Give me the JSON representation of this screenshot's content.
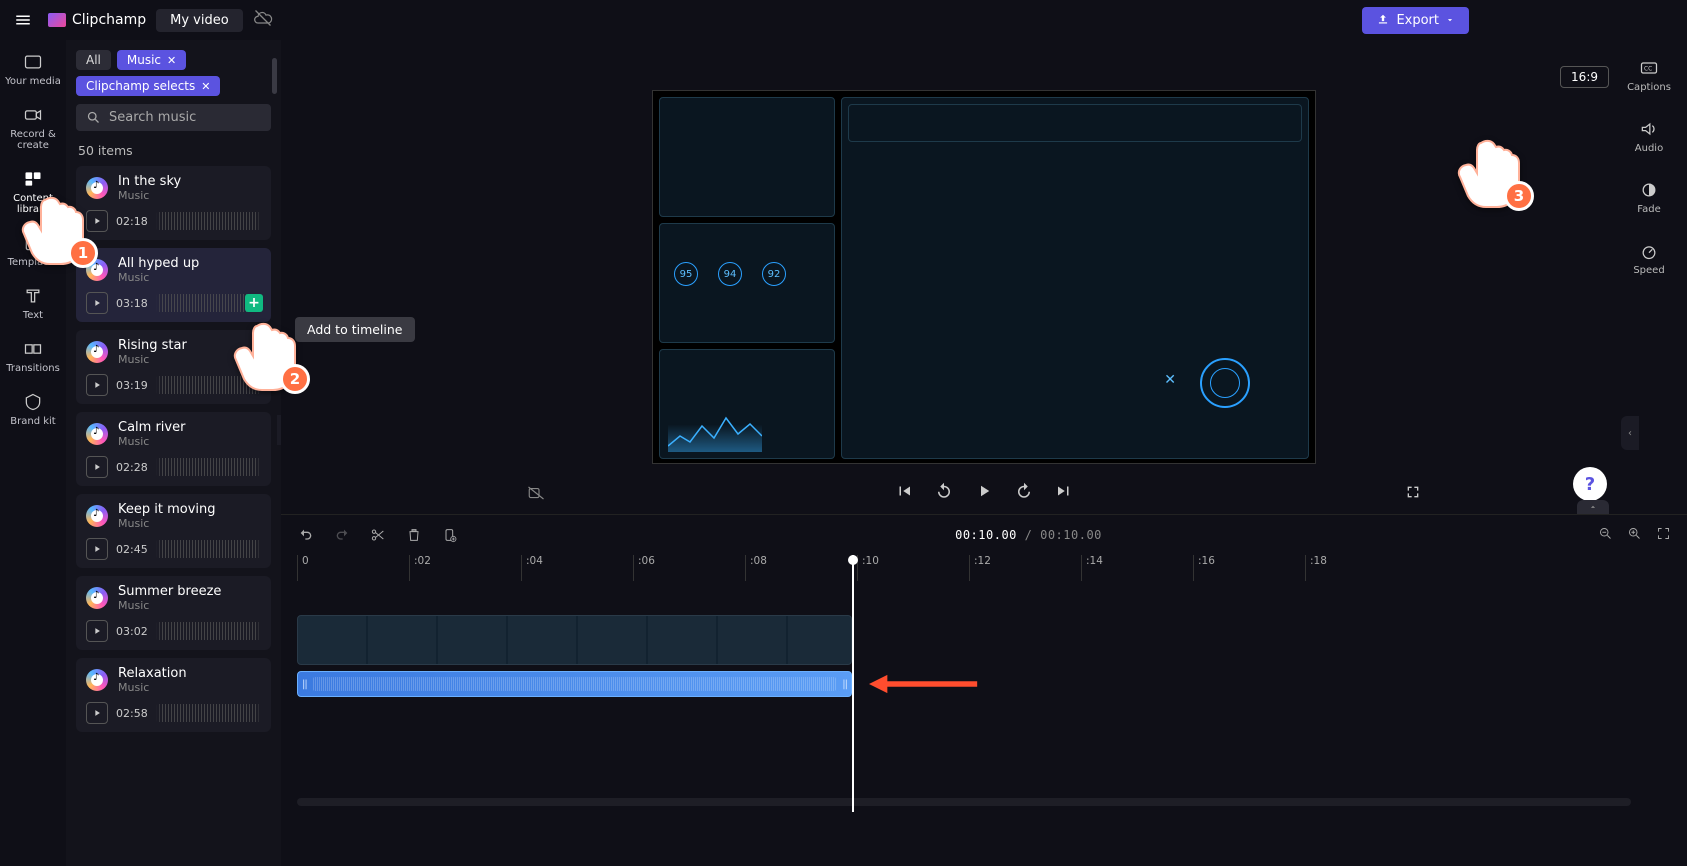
{
  "app": {
    "name": "Clipchamp",
    "project": "My video"
  },
  "export": {
    "label": "Export"
  },
  "nav": [
    {
      "label": "Your media",
      "active": false
    },
    {
      "label": "Record & create",
      "active": false
    },
    {
      "label": "Content library",
      "active": true
    },
    {
      "label": "Templates",
      "active": false
    },
    {
      "label": "Text",
      "active": false
    },
    {
      "label": "Transitions",
      "active": false
    },
    {
      "label": "Brand kit",
      "active": false
    }
  ],
  "library": {
    "chips": {
      "all": "All",
      "music": "Music",
      "selects": "Clipchamp selects"
    },
    "search_placeholder": "Search music",
    "count": "50 items",
    "tracks": [
      {
        "title": "In the sky",
        "sub": "Music",
        "dur": "02:18"
      },
      {
        "title": "All hyped up",
        "sub": "Music",
        "dur": "03:18",
        "hot": true
      },
      {
        "title": "Rising star",
        "sub": "Music",
        "dur": "03:19"
      },
      {
        "title": "Calm river",
        "sub": "Music",
        "dur": "02:28"
      },
      {
        "title": "Keep it moving",
        "sub": "Music",
        "dur": "02:45"
      },
      {
        "title": "Summer breeze",
        "sub": "Music",
        "dur": "03:02"
      },
      {
        "title": "Relaxation",
        "sub": "Music",
        "dur": "02:58"
      }
    ]
  },
  "tooltip": {
    "add": "Add to timeline"
  },
  "preview": {
    "aspect": "16:9",
    "nums": [
      "95",
      "94",
      "92"
    ]
  },
  "rightrail": [
    {
      "label": "Captions"
    },
    {
      "label": "Audio"
    },
    {
      "label": "Fade"
    },
    {
      "label": "Speed"
    }
  ],
  "help": {
    "q": "?"
  },
  "timeline": {
    "current": "00:10.00",
    "total": "00:10.00",
    "ticks": [
      "0",
      ":02",
      ":04",
      ":06",
      ":08",
      ":10",
      ":12",
      ":14",
      ":16",
      ":18"
    ]
  },
  "annotations": {
    "p1": "1",
    "p2": "2",
    "p3": "3"
  }
}
